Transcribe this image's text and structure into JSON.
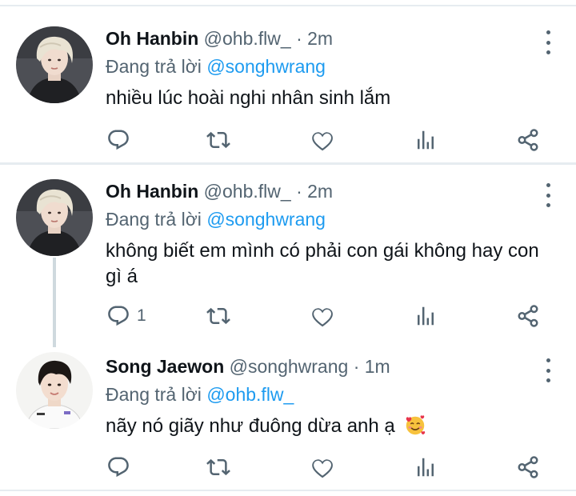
{
  "tweets": [
    {
      "name": "Oh Hanbin",
      "handle": "@ohb.flw_",
      "dot": " · ",
      "time": "2m",
      "reply_prefix": "Đang trả lời ",
      "reply_to": "@songhwrang",
      "text": "nhiều lúc hoài nghi nhân sinh lắm",
      "reply_count": ""
    },
    {
      "name": "Oh Hanbin",
      "handle": "@ohb.flw_",
      "dot": " · ",
      "time": "2m",
      "reply_prefix": "Đang trả lời ",
      "reply_to": "@songhwrang",
      "text": "không biết em mình có phải con gái không hay con gì á",
      "reply_count": "1"
    },
    {
      "name": "Song Jaewon",
      "handle": "@songhwrang",
      "dot": " · ",
      "time": "1m",
      "reply_prefix": "Đang trả lời ",
      "reply_to": "@ohb.flw_",
      "text": "nãy nó giãy như đuông dừa anh ạ",
      "reply_count": ""
    }
  ],
  "icons": {
    "reply": "reply-icon",
    "retweet": "retweet-icon",
    "like": "heart-icon",
    "stats": "stats-icon",
    "share": "share-icon",
    "more": "more-vertical-icon",
    "emoji": "smiling-face-with-hearts-emoji"
  },
  "colors": {
    "accent": "#1d9bf0",
    "secondary_text": "#536471",
    "separator": "#e6ecf0"
  }
}
